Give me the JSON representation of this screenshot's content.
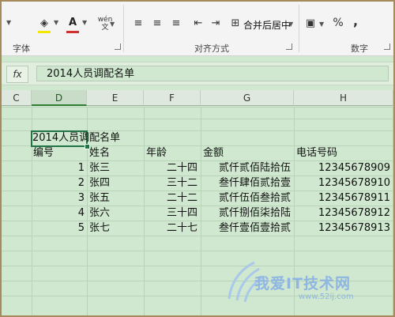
{
  "ribbon": {
    "groups": [
      {
        "label": "字体"
      },
      {
        "label": "对齐方式"
      },
      {
        "label": "数字"
      }
    ],
    "wrap_icon": "wén-wrap-icon",
    "merge_center_label": "合并后居中",
    "percent_label": "%",
    "comma_label": ","
  },
  "formula_bar": {
    "fx_label": "fx",
    "content": "2014人员调配名单"
  },
  "columns": [
    "C",
    "D",
    "E",
    "F",
    "G",
    "H"
  ],
  "active_column": "D",
  "sheet": {
    "title": "2014人员调配名单",
    "headers": [
      "编号",
      "姓名",
      "年龄",
      "金额",
      "电话号码"
    ],
    "rows": [
      {
        "id": "1",
        "name": "张三",
        "age": "二十四",
        "amount": "贰仟贰佰陆拾伍",
        "phone": "12345678909"
      },
      {
        "id": "2",
        "name": "张四",
        "age": "三十二",
        "amount": "叁仟肆佰贰拾壹",
        "phone": "12345678910"
      },
      {
        "id": "3",
        "name": "张五",
        "age": "二十二",
        "amount": "贰仟伍佰叁拾贰",
        "phone": "12345678911"
      },
      {
        "id": "4",
        "name": "张六",
        "age": "三十四",
        "amount": "贰仟捌佰柒拾陆",
        "phone": "12345678912"
      },
      {
        "id": "5",
        "name": "张七",
        "age": "二十七",
        "amount": "叁仟壹佰壹拾贰",
        "phone": "12345678913"
      }
    ]
  },
  "watermark": {
    "text": "我爱IT技术网",
    "url": "www.52ij.com"
  },
  "colors": {
    "grid_bg": "#cfe8cf",
    "accent": "#217346",
    "font_red": "#d32f2f",
    "fill_yellow": "#f3e600"
  }
}
